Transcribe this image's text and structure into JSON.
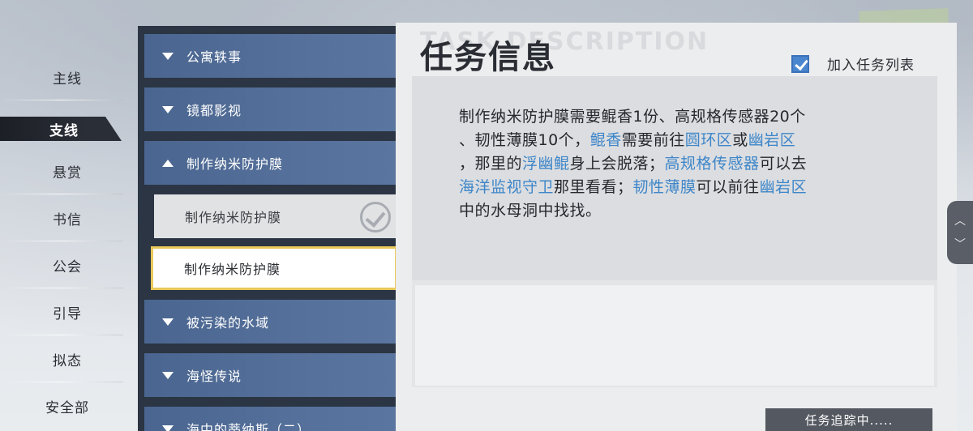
{
  "left_nav": {
    "items": [
      {
        "label": "主线"
      },
      {
        "label": "支线",
        "active": true
      },
      {
        "label": "悬赏"
      },
      {
        "label": "书信"
      },
      {
        "label": "公会"
      },
      {
        "label": "引导"
      },
      {
        "label": "拟态"
      },
      {
        "label": "安全部"
      }
    ]
  },
  "quest_list": {
    "categories": [
      {
        "label": "公寓轶事",
        "expanded": false
      },
      {
        "label": "镜都影视",
        "expanded": false
      },
      {
        "label": "制作纳米防护膜",
        "expanded": true
      },
      {
        "label": "被污染的水域",
        "expanded": false
      },
      {
        "label": "海怪传说",
        "expanded": false
      },
      {
        "label": "海中的蒂纳斯（二）",
        "expanded": false
      }
    ],
    "subitems": [
      {
        "label": "制作纳米防护膜",
        "state": "completed"
      },
      {
        "label": "制作纳米防护膜",
        "state": "selected"
      }
    ]
  },
  "panel": {
    "title": "任务信息",
    "title_ghost": "TASK DESCRIPTION",
    "track_label": "加入任务列表",
    "track_checked": true,
    "status": "任务追踪中.....",
    "description": {
      "l1": "制作纳米防护膜需要鲲香1份、高规格传感器20个",
      "l2a": "、韧性薄膜10个，",
      "l2k1": "鲲香",
      "l2b": "需要前往",
      "l2k2": "圆环区",
      "l2c": "或",
      "l2k3": "幽岩区",
      "l3a": "，那里的",
      "l3k1": "浮幽鲲",
      "l3b": "身上会脱落；",
      "l3k2": "高规格传感器",
      "l3c": "可以去",
      "l4k1": "海洋监视守卫",
      "l4a": "那里看看；",
      "l4k2": "韧性薄膜",
      "l4b": "可以前往",
      "l4k3": "幽岩区",
      "l5": "中的水母洞中找找。"
    }
  },
  "colors": {
    "keyword": "#3d86c9",
    "category_bg": "#55709a",
    "selected_border": "#e8c85a",
    "checkbox": "#4a86cf"
  },
  "icons": [
    "triangle-down-icon",
    "triangle-up-icon",
    "check-circle-icon",
    "checkbox-icon",
    "chevron-up-icon",
    "chevron-down-icon"
  ]
}
